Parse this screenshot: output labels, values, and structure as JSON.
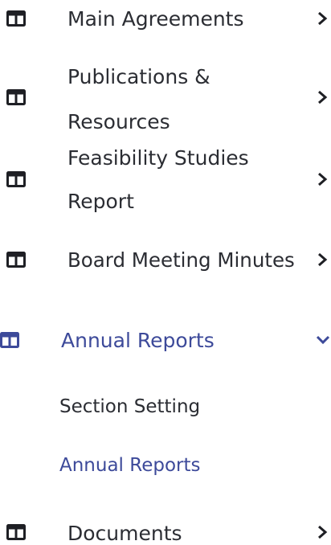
{
  "accent_color": "#3d4a9a",
  "text_color": "#2b2d33",
  "menu": {
    "items": [
      {
        "label": "Main Agreements",
        "icon": "table-icon",
        "chevron": "chevron-right-icon"
      },
      {
        "label": "Publications & Resources",
        "icon": "table-icon",
        "chevron": "chevron-right-icon"
      },
      {
        "label": "Feasibility Studies Report",
        "icon": "table-icon",
        "chevron": "chevron-right-icon"
      },
      {
        "label": "Board Meeting Minutes",
        "icon": "table-icon",
        "chevron": "chevron-right-icon"
      },
      {
        "label": "Annual Reports",
        "icon": "table-icon",
        "chevron": "chevron-down-icon",
        "expanded": true,
        "children": [
          {
            "label": "Section Setting"
          },
          {
            "label": "Annual Reports",
            "active": true
          }
        ]
      },
      {
        "label": "Documents",
        "icon": "table-icon",
        "chevron": "chevron-right-icon"
      }
    ]
  }
}
